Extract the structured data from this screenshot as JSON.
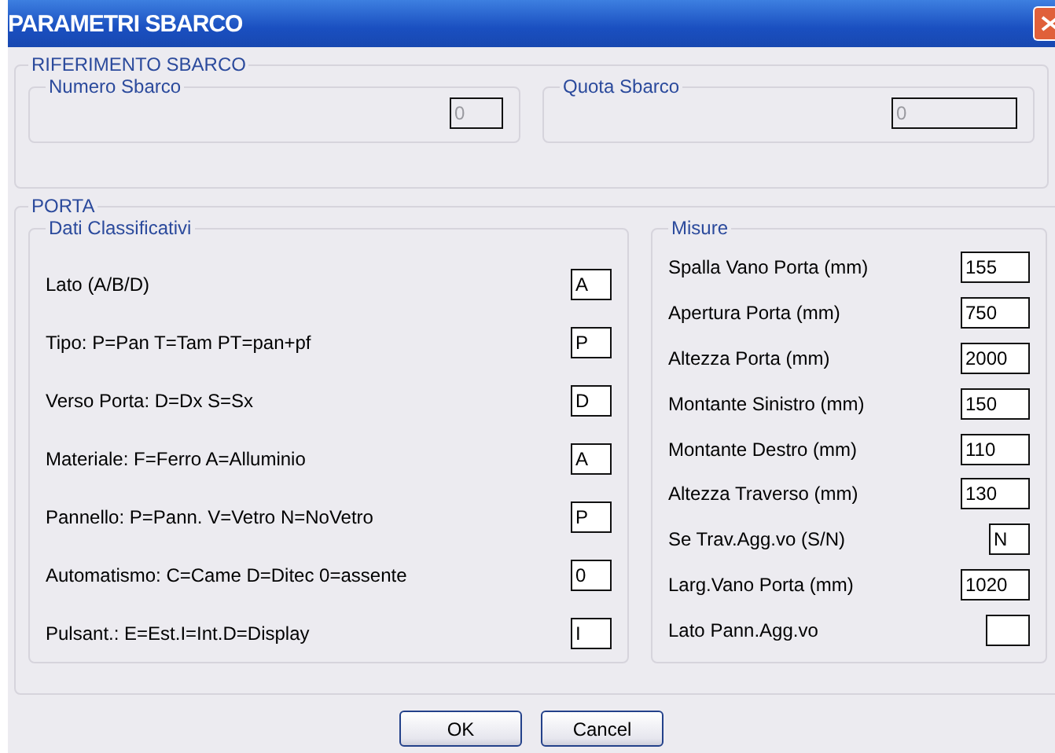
{
  "window": {
    "title": "PARAMETRI SBARCO"
  },
  "riferimento": {
    "title": "RIFERIMENTO SBARCO",
    "fields": [
      {
        "label": "Numero Sbarco",
        "value": "0",
        "disabled": true
      },
      {
        "label": "Quota Sbarco",
        "value": "0",
        "disabled": true
      }
    ]
  },
  "porta": {
    "title": "PORTA",
    "dati": {
      "title": "Dati Classificativi",
      "rows": [
        {
          "label": "Lato (A/B/D)",
          "value": "A"
        },
        {
          "label": "Tipo: P=Pan T=Tam PT=pan+pf",
          "value": "P"
        },
        {
          "label": "Verso Porta: D=Dx S=Sx",
          "value": "D"
        },
        {
          "label": "Materiale: F=Ferro A=Alluminio",
          "value": "A"
        },
        {
          "label": "Pannello: P=Pann. V=Vetro N=NoVetro",
          "value": "P"
        },
        {
          "label": "Automatismo: C=Came D=Ditec 0=assente",
          "value": "0"
        },
        {
          "label": "Pulsant.: E=Est.I=Int.D=Display",
          "value": "I"
        }
      ]
    },
    "misure": {
      "title": "Misure",
      "rows": [
        {
          "label": "Spalla Vano Porta (mm)",
          "value": "155"
        },
        {
          "label": "Apertura Porta (mm)",
          "value": "750"
        },
        {
          "label": "Altezza Porta (mm)",
          "value": "2000"
        },
        {
          "label": "Montante Sinistro (mm)",
          "value": "150"
        },
        {
          "label": "Montante Destro (mm)",
          "value": "110"
        },
        {
          "label": "Altezza Traverso (mm)",
          "value": "130"
        },
        {
          "label": "Se Trav.Agg.vo (S/N)",
          "value": "N"
        },
        {
          "label": "Larg.Vano Porta (mm)",
          "value": "1020"
        },
        {
          "label": "Lato Pann.Agg.vo",
          "value": ""
        }
      ]
    }
  },
  "buttons": [
    {
      "label": "OK"
    },
    {
      "label": "Cancel"
    }
  ]
}
